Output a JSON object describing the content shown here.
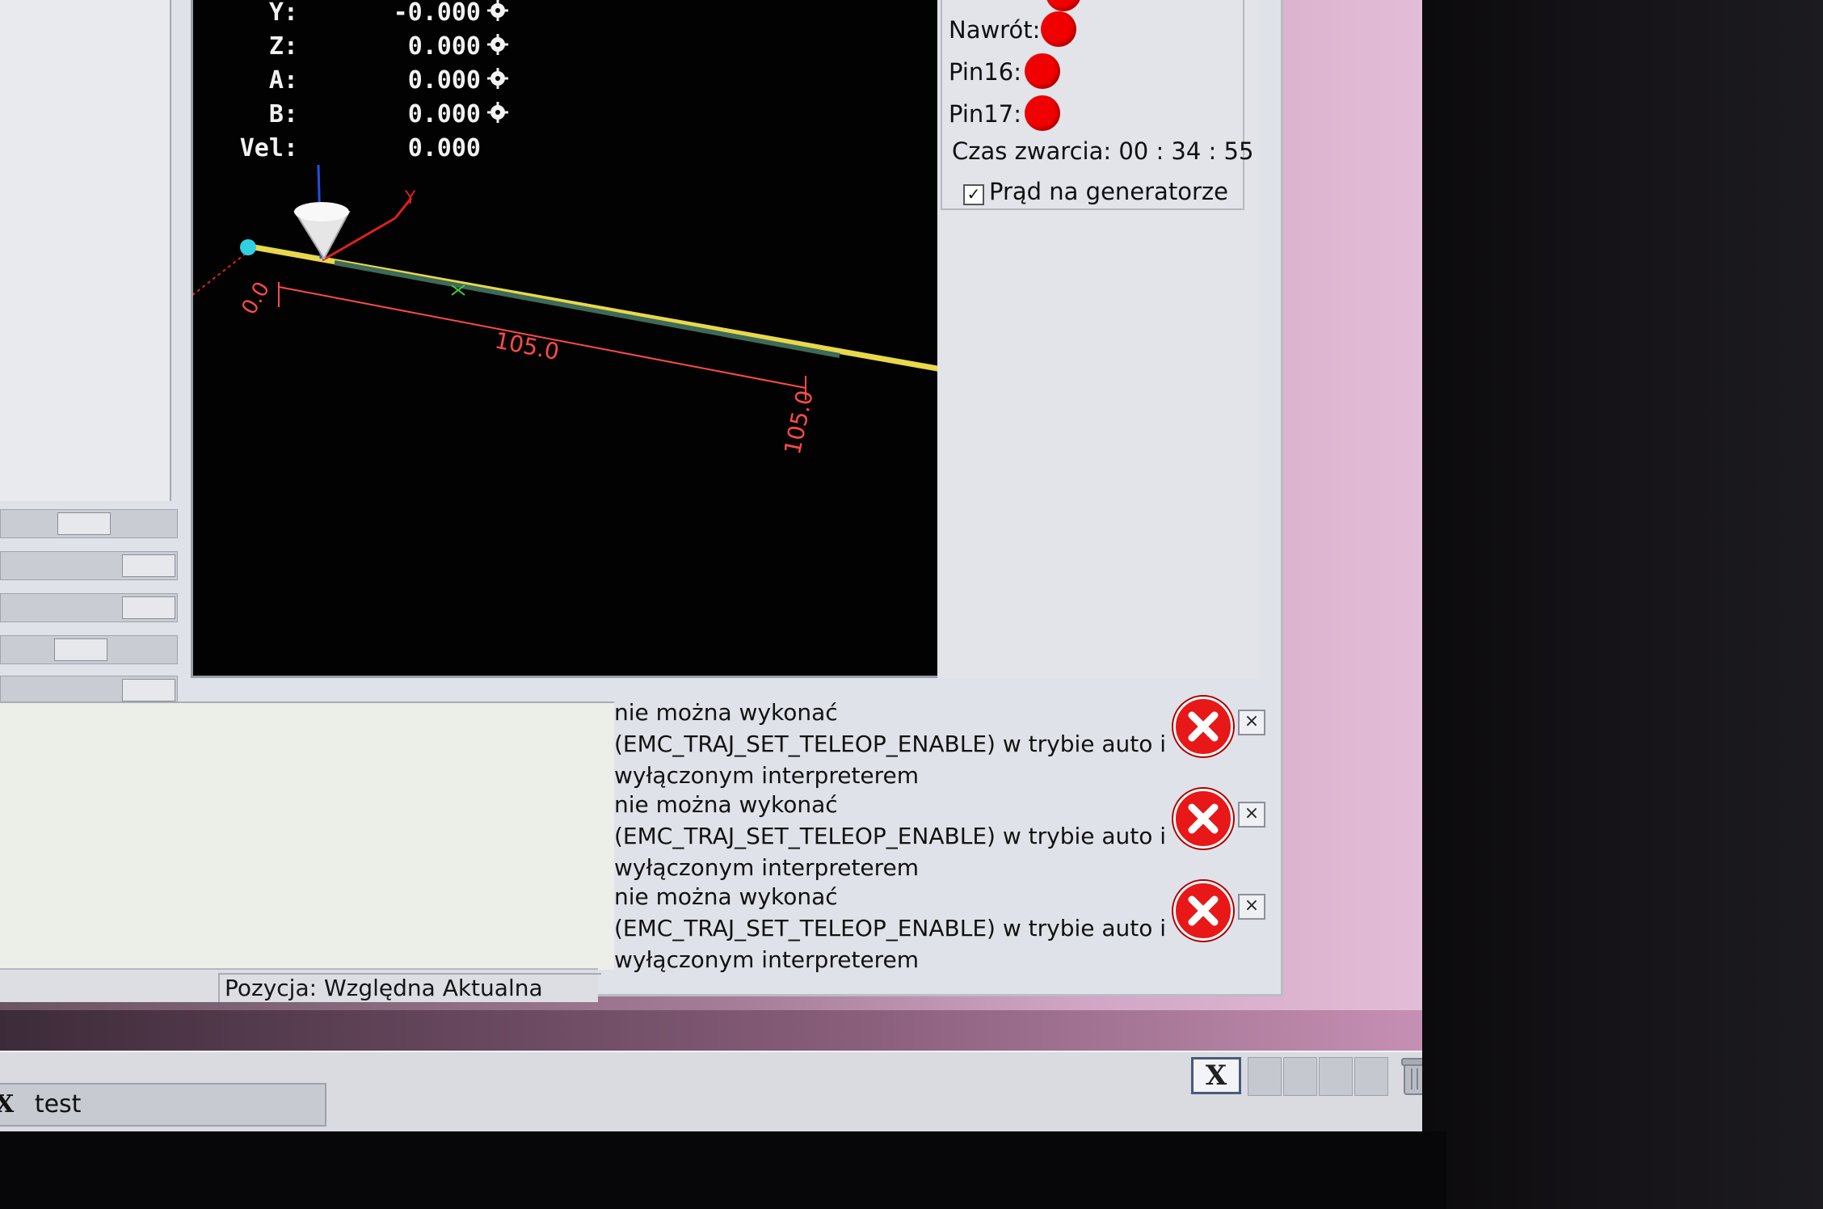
{
  "dro": {
    "rows": [
      {
        "label": "Y:",
        "value": "-0.000"
      },
      {
        "label": "Z:",
        "value": "0.000"
      },
      {
        "label": "A:",
        "value": "0.000"
      },
      {
        "label": "B:",
        "value": "0.000"
      },
      {
        "label": "Vel:",
        "value": "0.000"
      }
    ]
  },
  "preview": {
    "dim_start": "0.0",
    "dim_mid": "105.0",
    "dim_end": "105.0",
    "axis_label_y": "Y"
  },
  "pins": {
    "nawrot": "Nawrót:",
    "pin16": "Pin16:",
    "pin17": "Pin17:",
    "led_color": "#f00000",
    "short_circuit_time": "Czas zwarcia: 00 : 34 : 55",
    "generator_current_label": "Prąd na generatorze",
    "generator_current_checked": true
  },
  "messages": [
    {
      "line1": "nie można wykonać",
      "line2": "(EMC_TRAJ_SET_TELEOP_ENABLE) w trybie auto i",
      "line3": "wyłączonym interpreterem"
    },
    {
      "line1": "nie można wykonać",
      "line2": "(EMC_TRAJ_SET_TELEOP_ENABLE) w trybie auto i",
      "line3": "wyłączonym interpreterem"
    },
    {
      "line1": "nie można wykonać",
      "line2": "(EMC_TRAJ_SET_TELEOP_ENABLE) w trybie auto i",
      "line3": "wyłączonym interpreterem"
    }
  ],
  "status": {
    "position_mode": "Pozycja: Względna Aktualna"
  },
  "taskbar": {
    "task_label": "test",
    "task_icon": "X",
    "tray_x": "X"
  },
  "colors": {
    "error": "#e81818",
    "toolpath": "#e8d84a",
    "dimension": "#ff4a4a"
  }
}
